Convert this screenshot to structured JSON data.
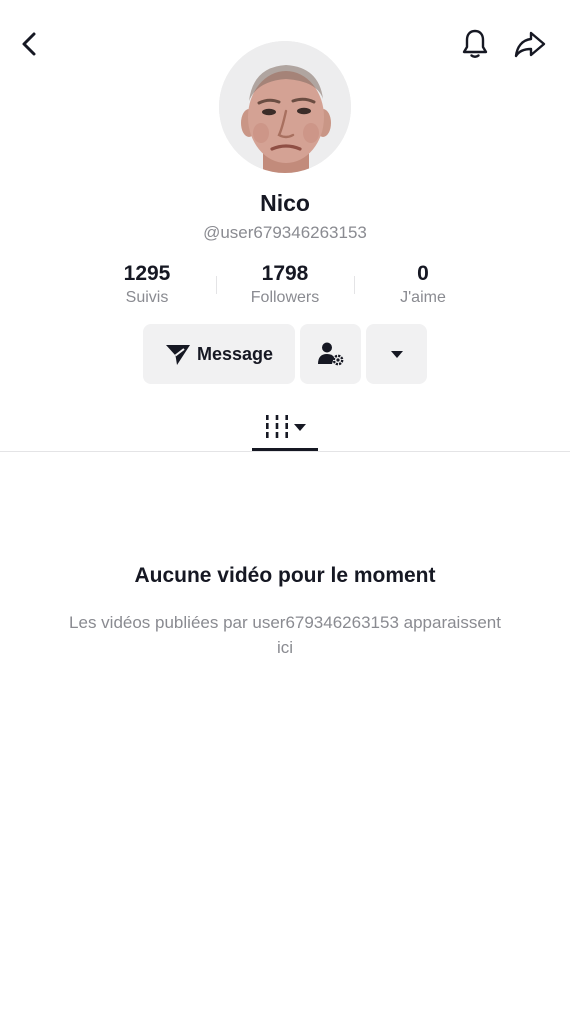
{
  "header": {
    "back_icon": "chevron-left-icon",
    "notification_icon": "bell-icon",
    "share_icon": "share-arrow-icon"
  },
  "profile": {
    "display_name": "Nico",
    "username": "@user679346263153"
  },
  "stats": [
    {
      "value": "1295",
      "label": "Suivis"
    },
    {
      "value": "1798",
      "label": "Followers"
    },
    {
      "value": "0",
      "label": "J'aime"
    }
  ],
  "actions": {
    "message_label": "Message",
    "message_icon": "paper-plane-icon",
    "friends_icon": "person-gear-icon",
    "more_icon": "caret-down-icon"
  },
  "tabs": {
    "active_icon": "videos-grid-icon"
  },
  "empty_state": {
    "title": "Aucune vidéo pour le moment",
    "description": "Les vidéos publiées par user679346263153 apparaissent ici"
  }
}
